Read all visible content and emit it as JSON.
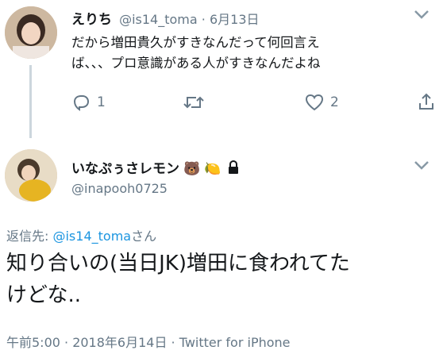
{
  "parent_tweet": {
    "display_name": "えりち",
    "handle": "@is14_toma",
    "separator": "·",
    "date": "6月13日",
    "text_line1": "だから増田貴久がすきなんだって何回言え",
    "text_line2": "ば、、、プロ意識がある人がすきなんだよね",
    "reply_count": "1",
    "like_count": "2"
  },
  "main_tweet": {
    "display_name": "いなぷぅさレモン",
    "emoji_bear": "🐻",
    "emoji_lemon": "🍋",
    "handle": "@inapooh0725",
    "reply_label": "返信先: ",
    "reply_mention": "@is14_toma",
    "reply_suffix": "さん",
    "text_line1": "知り合いの(当日JK)増田に食われてた",
    "text_line2": "けどな..",
    "timestamp": "午前5:00 · 2018年6月14日 · Twitter for iPhone"
  },
  "colors": {
    "accent": "#1b95e0",
    "secondary_text": "#657786",
    "thread_line": "#ccd6dd"
  }
}
